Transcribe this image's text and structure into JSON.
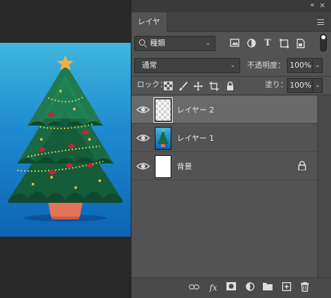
{
  "panel": {
    "collapse_icon": "«",
    "close_icon": "×",
    "tab_label": "レイヤー"
  },
  "filter": {
    "kind_value": "種類",
    "icons": [
      "image-filter-icon",
      "adjustment-filter-icon",
      "type-filter-icon",
      "shape-filter-icon",
      "smartobject-filter-icon"
    ]
  },
  "blend": {
    "mode_value": "通常",
    "opacity_label": "不透明度：",
    "opacity_value": "100%"
  },
  "lock": {
    "label": "ロック：",
    "fill_label": "塗り：",
    "fill_value": "100%"
  },
  "layers": [
    {
      "name": "レイヤー 2",
      "thumb": "transparent",
      "selected": true
    },
    {
      "name": "レイヤー 1",
      "thumb": "tree",
      "selected": false
    },
    {
      "name": "背景",
      "thumb": "white",
      "selected": false,
      "locked": true
    }
  ],
  "footer": {
    "fx_label": "fx"
  },
  "colors": {
    "panel_bg": "#535353",
    "selected_row": "#6a6a6a",
    "sky_top": "#3fb6de",
    "sky_bottom": "#0c63b4",
    "tree": "#1e6b45",
    "pot": "#e3735a",
    "star": "#f4b03c",
    "bow": "#c0263b"
  }
}
